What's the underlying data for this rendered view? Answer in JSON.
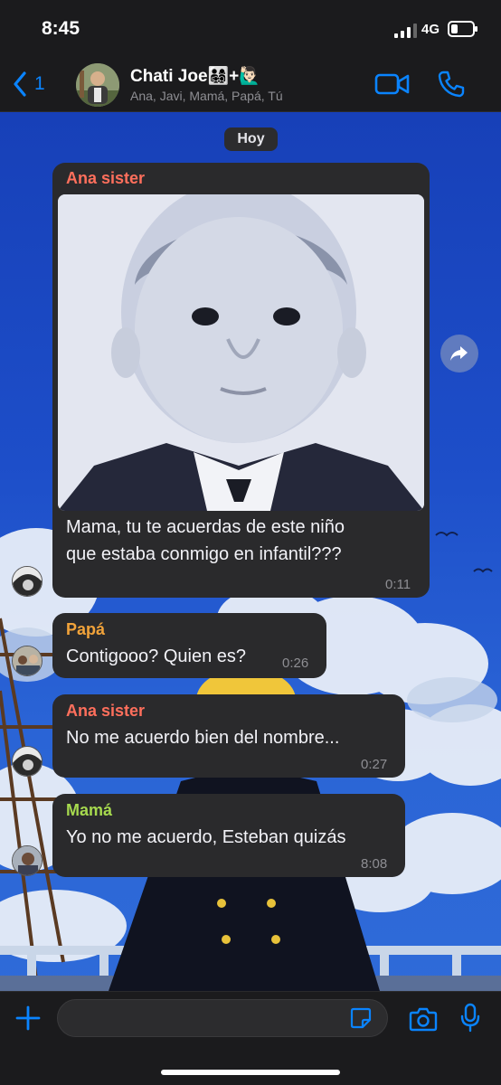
{
  "status_bar": {
    "time": "8:45",
    "network": "4G"
  },
  "header": {
    "back_count": "1",
    "title": "Chati Joe👨‍👩‍👧‍👦+🙋🏻‍♂️",
    "members": "Ana, Javi, Mamá, Papá, Tú"
  },
  "chat": {
    "date_label": "Hoy",
    "messages": [
      {
        "sender": "Ana sister",
        "sender_color": "#ff6f5c",
        "text_line1": "Mama, tu te acuerdas de este niño",
        "text_line2": "que estaba conmigo en infantil???",
        "time": "0:11",
        "has_photo": true
      },
      {
        "sender": "Papá",
        "sender_color": "#f2a33a",
        "text": "Contigooo? Quien es?",
        "time": "0:26"
      },
      {
        "sender": "Ana sister",
        "sender_color": "#ff6f5c",
        "text": "No me acuerdo bien del nombre...",
        "time": "0:27"
      },
      {
        "sender": "Mamá",
        "sender_color": "#a6d94e",
        "text": "Yo no me acuerdo, Esteban quizás",
        "time": "8:08"
      }
    ]
  },
  "icons": {
    "back": "chevron-left-icon",
    "video": "video-camera-icon",
    "call": "phone-icon",
    "forward": "forward-arrow-icon",
    "plus": "plus-icon",
    "sticker": "sticker-icon",
    "camera": "camera-icon",
    "mic": "microphone-icon"
  },
  "colors": {
    "accent": "#0a84ff",
    "bubble": "#2a2a2c",
    "bar": "#1b1b1d"
  }
}
